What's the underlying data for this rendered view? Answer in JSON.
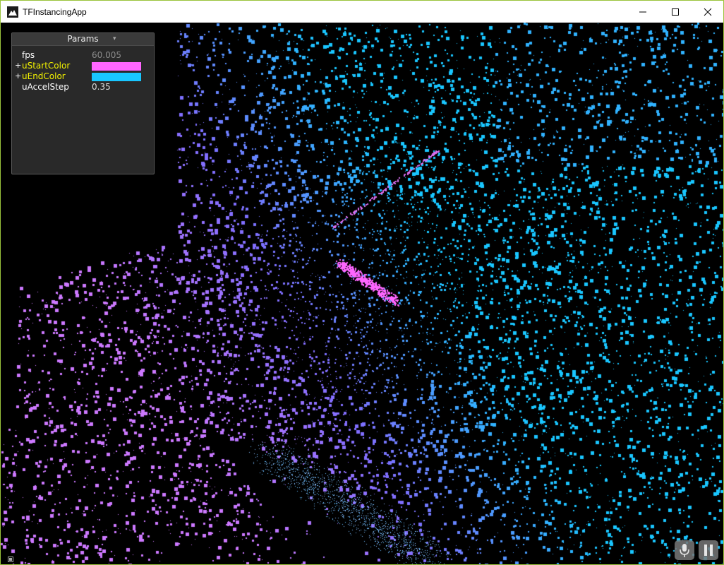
{
  "window": {
    "title": "TFInstancingApp",
    "controls": {
      "minimize": "minimize-icon",
      "maximize": "maximize-icon",
      "close": "close-icon"
    }
  },
  "params": {
    "title": "Params",
    "rows": [
      {
        "label": "fps",
        "value": "60.005",
        "kind": "readonly"
      },
      {
        "label": "uStartColor",
        "color": "#ff66ff",
        "kind": "color"
      },
      {
        "label": "uEndColor",
        "color": "#19c6ff",
        "kind": "color"
      },
      {
        "label": "uAccelStep",
        "value": "0.35",
        "kind": "number"
      }
    ]
  },
  "render": {
    "background": "#000000",
    "start_color": "#ff66ff",
    "end_color": "#19c6ff",
    "particle_icon": "square-particles"
  },
  "hud": {
    "mic": "microphone-icon",
    "pause": "pause-icon",
    "corner": "info-icon"
  }
}
